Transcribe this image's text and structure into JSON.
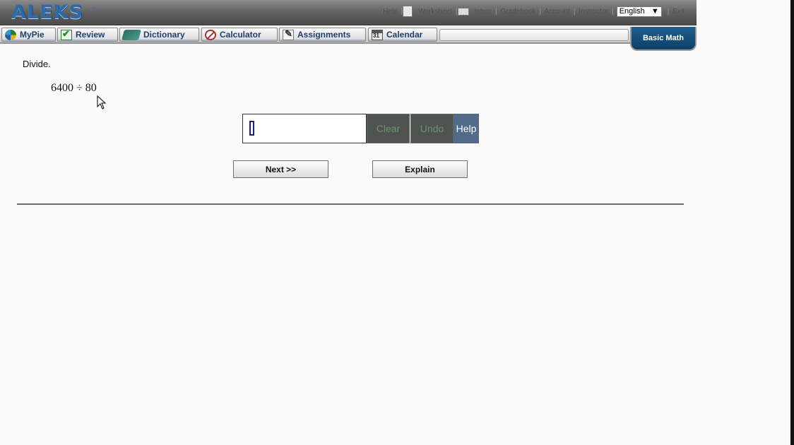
{
  "header": {
    "logo": "ALEKS",
    "logo_tm": "®",
    "links": [
      {
        "name": "link-1",
        "label": "Help"
      },
      {
        "name": "link-2",
        "label": "Worksheet"
      },
      {
        "name": "link-3",
        "label": "Inbox"
      },
      {
        "name": "link-4",
        "label": "Gradebook"
      },
      {
        "name": "link-5",
        "label": "Account"
      },
      {
        "name": "link-6",
        "label": "Instructor"
      }
    ],
    "language": "English",
    "exit_label": "Exit"
  },
  "tabs": [
    {
      "id": "mypie",
      "label": "MyPie",
      "icon": "pie-chart-icon"
    },
    {
      "id": "review",
      "label": "Review",
      "icon": "checkmark-icon"
    },
    {
      "id": "dictionary",
      "label": "Dictionary",
      "icon": "book-icon"
    },
    {
      "id": "calculator",
      "label": "Calculator",
      "icon": "no-calculator-icon"
    },
    {
      "id": "assignments",
      "label": "Assignments",
      "icon": "assignment-icon"
    },
    {
      "id": "calendar",
      "label": "Calendar",
      "icon": "calendar-icon"
    }
  ],
  "course": "Basic Math",
  "problem": {
    "instruction": "Divide.",
    "expression": "6400 ÷ 80",
    "answer_value": ""
  },
  "tools": {
    "clear": "Clear",
    "undo": "Undo",
    "help": "Help"
  },
  "navigation": {
    "next": "Next >>",
    "explain": "Explain"
  },
  "colors": {
    "logo": "#2f6aa8",
    "tab_text": "#1f3e6e",
    "course_badge": "#0e3f66",
    "tool_button": "#4e534f",
    "help_button": "#516b88"
  }
}
